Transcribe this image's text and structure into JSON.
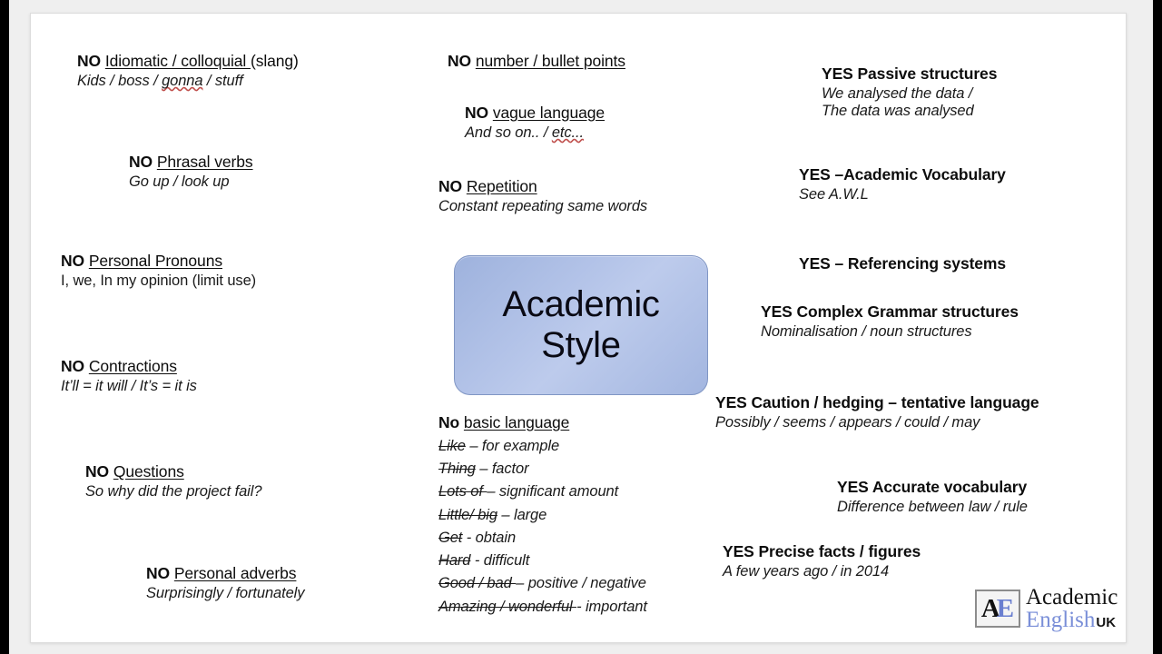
{
  "slide": {
    "title_box": {
      "line1": "Academic",
      "line2": "Style",
      "fill_color": "#b0c0e6",
      "border_color": "#8096c4"
    },
    "left_column": [
      {
        "tag": "NO",
        "topic": "Idiomatic / colloquial ",
        "trail": "(slang)",
        "example": "Kids / boss / gonna / stuff",
        "squiggle_word": "gonna"
      },
      {
        "tag": "NO",
        "topic": "Phrasal verbs",
        "trail": "",
        "example": "Go up / look up"
      },
      {
        "tag": "NO",
        "topic": "Personal Pronouns",
        "trail": "",
        "example": "I, we, In my opinion (limit use)",
        "example_upright": true
      },
      {
        "tag": "NO",
        "topic": "Contractions ",
        "trail": "",
        "example": "It’ll = it will / It’s = it is"
      },
      {
        "tag": "NO",
        "topic": "Questions",
        "trail": "",
        "example": "So why did the project fail?"
      },
      {
        "tag": "NO",
        "topic": "Personal adverbs",
        "trail": "",
        "example": "Surprisingly / fortunately"
      }
    ],
    "middle_column": [
      {
        "tag": "NO",
        "topic": "number / bullet points",
        "trail": "",
        "example": ""
      },
      {
        "tag": "NO",
        "topic": "vague language",
        "trail": "",
        "example": "And so on.. / etc...",
        "squiggle_word": "etc..."
      },
      {
        "tag": "NO",
        "topic": "Repetition",
        "trail": "",
        "example": "Constant repeating same words"
      }
    ],
    "basic_language": {
      "tag": "No",
      "topic": "basic language",
      "rows": [
        {
          "bad": "Like",
          "sep": " – ",
          "good": "for example"
        },
        {
          "bad": "Thing",
          "sep": " – ",
          "good": "factor"
        },
        {
          "bad": "Lots of ",
          "sep": "– ",
          "good": "significant amount"
        },
        {
          "bad": "Little/ big",
          "sep": " – ",
          "good": "large"
        },
        {
          "bad": "Get",
          "sep": " -  ",
          "good": "obtain"
        },
        {
          "bad": "Hard",
          "sep": " - ",
          "good": "difficult"
        },
        {
          "bad": "Good / bad ",
          "sep": "– ",
          "good": "positive / negative"
        },
        {
          "bad": "Amazing / wonderful ",
          "sep": "- ",
          "good": "important"
        }
      ]
    },
    "right_column": [
      {
        "heading": "YES Passive structures",
        "example": "We analysed the data /",
        "example2": "The data was analysed"
      },
      {
        "heading": "YES –Academic Vocabulary",
        "example": "See A.W.L"
      },
      {
        "heading": "YES – Referencing systems",
        "example": ""
      },
      {
        "heading": "YES Complex Grammar structures",
        "example": "Nominalisation / noun structures"
      },
      {
        "heading": "YES Caution / hedging – tentative language",
        "example": "Possibly / seems / appears / could / may"
      },
      {
        "heading": "YES Accurate vocabulary",
        "example": "Difference between law / rule"
      },
      {
        "heading": "YES Precise facts / figures",
        "example": "A few years ago / in 2014"
      }
    ],
    "logo": {
      "mark_a": "A",
      "mark_e": "E",
      "word1": "Academic",
      "word2": "English",
      "word3": "UK",
      "accent_color": "#7a8fd8"
    }
  }
}
